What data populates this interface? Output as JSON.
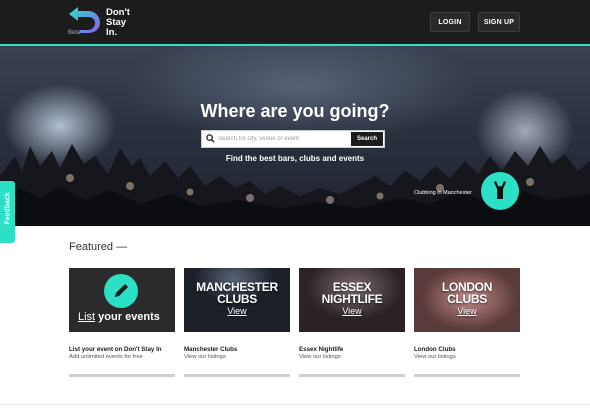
{
  "header": {
    "logo_text_lines": [
      "Don't",
      "Stay",
      "In."
    ],
    "beta": "Beta",
    "login_label": "LOGIN",
    "signup_label": "SIGN UP"
  },
  "hero": {
    "title": "Where are you going?",
    "search_placeholder": "Search for city, venue or event",
    "search_button": "Search",
    "subtitle": "Find the best bars, clubs and events",
    "caption": "Clubbing in Manchester"
  },
  "feedback": {
    "label": "Feedback"
  },
  "featured": {
    "title": "Featured —",
    "cards": [
      {
        "overlay_lead": "List",
        "overlay_rest": " your events",
        "title": "List your event on Don't Stay In",
        "desc": "Add unlimited events for free"
      },
      {
        "overlay_line1": "MANCHESTER",
        "overlay_line2": "CLUBS",
        "overlay_view": "View",
        "title": "Manchester Clubs",
        "desc": "View our listings"
      },
      {
        "overlay_line1": "ESSEX",
        "overlay_line2": "NIGHTLIFE",
        "overlay_view": "View",
        "title": "Essex Nightlife",
        "desc": "View our listings"
      },
      {
        "overlay_line1": "LONDON",
        "overlay_line2": "CLUBS",
        "overlay_view": "View",
        "title": "London Clubs",
        "desc": "View our listings"
      }
    ]
  },
  "colors": {
    "accent": "#2be0c4",
    "header_bg": "#1c1c1c"
  }
}
